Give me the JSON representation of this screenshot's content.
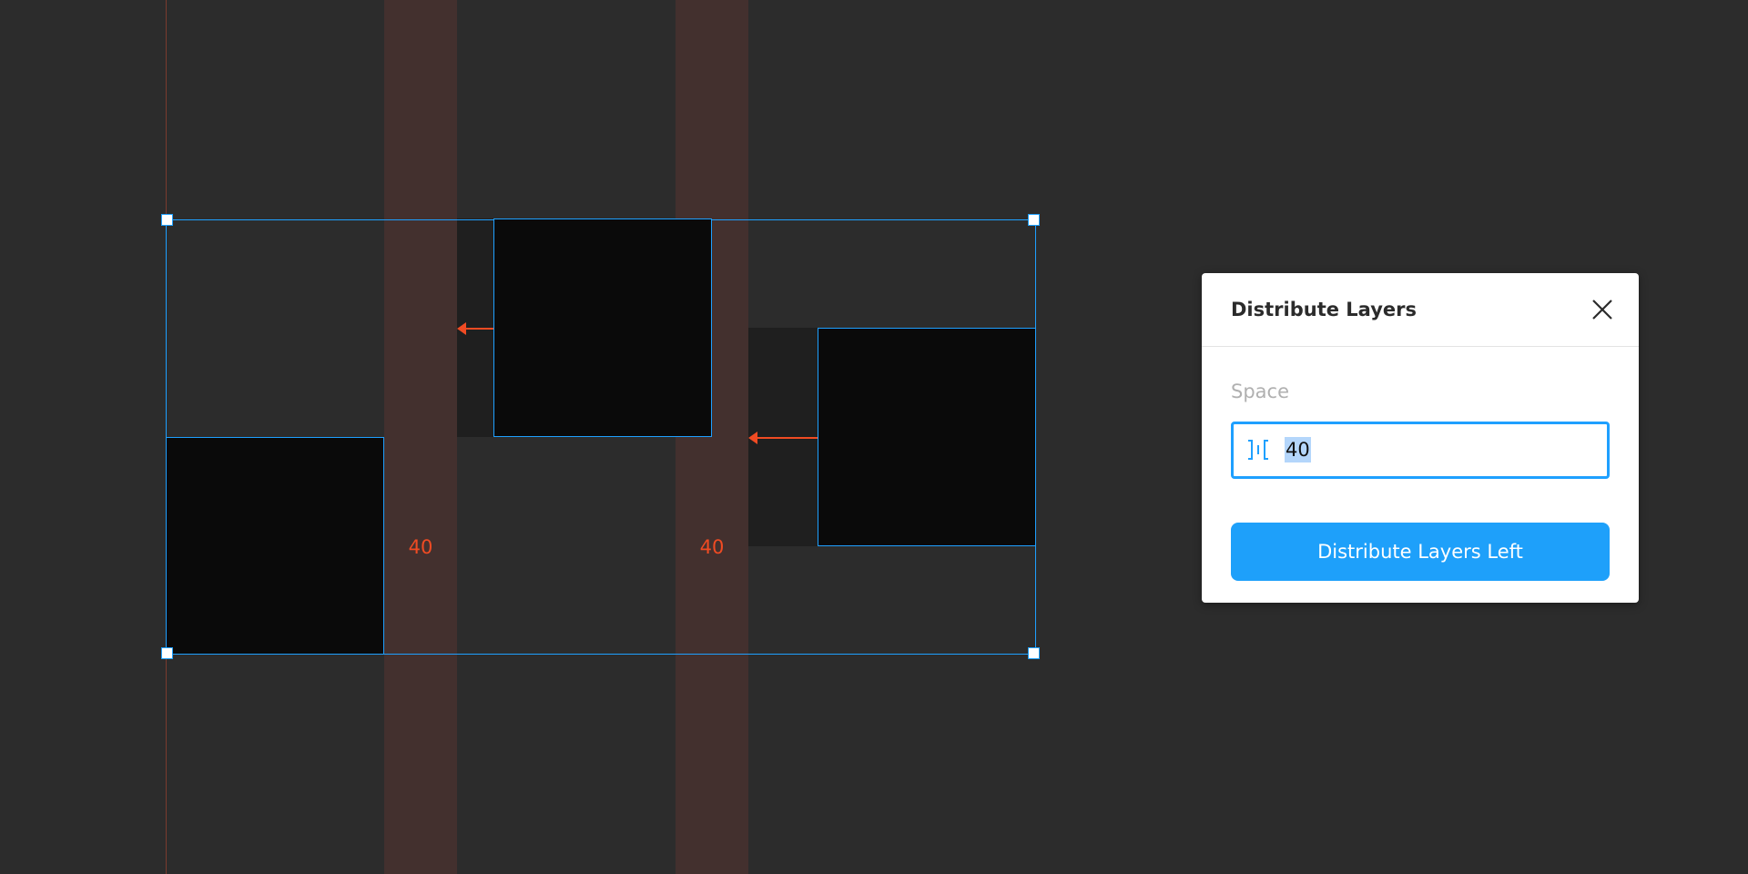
{
  "canvas": {
    "gap_labels": [
      "40",
      "40"
    ]
  },
  "dialog": {
    "title": "Distribute Layers",
    "close_icon": "close-icon",
    "field_label": "Space",
    "spacing_icon": "horizontal-spacing-icon",
    "space_value": "40",
    "button_label": "Distribute Layers Left"
  },
  "colors": {
    "background": "#2c2c2c",
    "selection": "#1ea0ff",
    "measurement": "#f04b23",
    "gap_band": "#43302e",
    "layer_fill": "#0a0a0a",
    "primary_button": "#1ea0fa"
  }
}
